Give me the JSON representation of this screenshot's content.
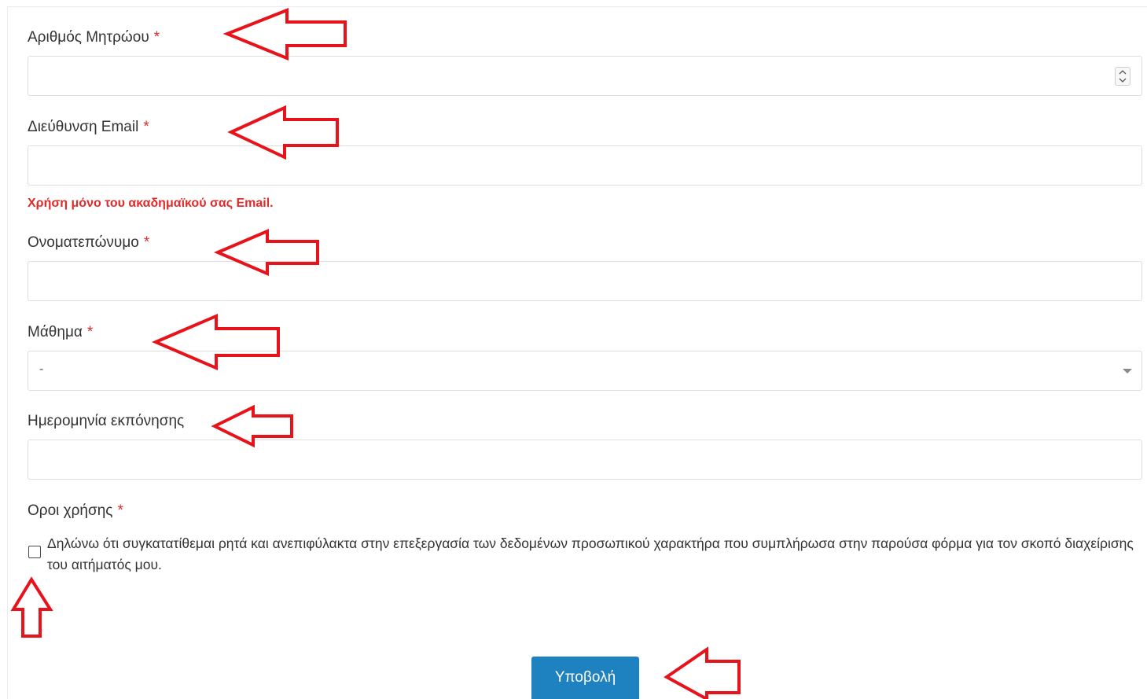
{
  "form": {
    "fields": [
      {
        "label": "Αριθμός Μητρώου",
        "required_mark": "*",
        "value": ""
      },
      {
        "label": "Διεύθυνση Email",
        "required_mark": "*",
        "value": ""
      },
      {
        "label": "Ονοματεπώνυμο",
        "required_mark": "*",
        "value": ""
      },
      {
        "label": "Μάθημα",
        "required_mark": "*",
        "selected": "-"
      },
      {
        "label": "Ημερομηνία εκπόνησης",
        "value": ""
      }
    ],
    "email_hint": "Χρήση μόνο του ακαδημαϊκού σας Email.",
    "terms": {
      "label": "Οροι χρήσης",
      "required_mark": "*",
      "checked": false,
      "consent_text": "Δηλώνω ότι συγκατατίθεμαι ρητά και ανεπιφύλακτα στην επεξεργασία των δεδομένων προσωπικού χαρακτήρα που συμπλήρωσα στην παρούσα φόρμα για τον σκοπό διαχείρισης του αιτήματός μου."
    },
    "submit_label": "Υποβολή"
  },
  "colors": {
    "required": "#e02b2b",
    "hint": "#e02b2b",
    "submit_bg": "#1f82c0",
    "annotation_arrow": "#e8121a"
  },
  "icons": {
    "number_spinner": "up-down-chevron-icon",
    "select_caret": "caret-down-icon",
    "annotations": "arrow-outline-icon"
  }
}
